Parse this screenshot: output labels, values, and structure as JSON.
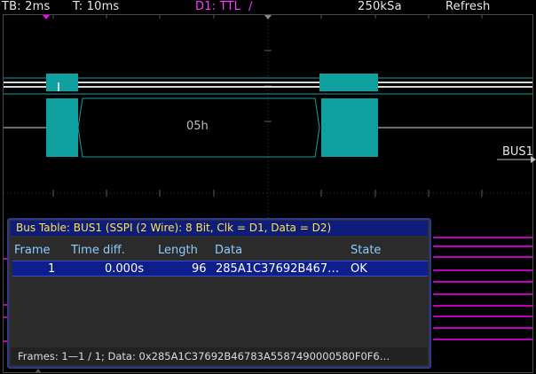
{
  "topbar": {
    "timebase": "TB: 2ms",
    "trigger_pos": "T: 10ms",
    "trigger_source": "D1: TTL",
    "trigger_edge": "∕",
    "sample_rate": "250kSa",
    "acquisition_mode": "Refresh"
  },
  "waveform": {
    "bus_label": "BUS1",
    "decoded_value": "05h",
    "colors": {
      "digital": "#ff00ff",
      "bus": "#0fa0a0",
      "grid": "#3a3a3a"
    }
  },
  "bus_table": {
    "title": "Bus Table: BUS1 (SSPI (2 Wire): 8 Bit, Clk = D1, Data = D2)",
    "columns": [
      "Frame",
      "Time diff.",
      "Length",
      "Data",
      "State"
    ],
    "rows": [
      {
        "frame": "1",
        "time_diff": "0.000s",
        "length": "96",
        "data": "285A1C37692B467…",
        "state": "OK"
      }
    ],
    "footer": "Frames:  1—1 / 1; Data: 0x285A1C37692B46783A5587490000580F0F6…"
  }
}
